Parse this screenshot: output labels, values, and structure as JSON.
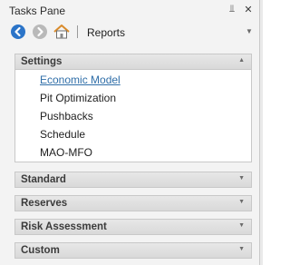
{
  "titlebar": {
    "title": "Tasks Pane",
    "pin_glyph": "⫫",
    "close_glyph": "✕"
  },
  "navbar": {
    "title": "Reports"
  },
  "sections": [
    {
      "title": "Settings",
      "expanded": true,
      "items": [
        "Economic Model",
        "Pit Optimization",
        "Pushbacks",
        "Schedule",
        "MAO-MFO"
      ]
    },
    {
      "title": "Standard",
      "expanded": false
    },
    {
      "title": "Reserves",
      "expanded": false
    },
    {
      "title": "Risk Assessment",
      "expanded": false
    },
    {
      "title": "Custom",
      "expanded": false
    }
  ],
  "glyphs": {
    "chevron_up": "▲",
    "chevron_down": "▼",
    "dropdown": "▼"
  },
  "colors": {
    "back_button": "#2b74c8",
    "forward_button": "#b9b9b9",
    "link": "#2f6ea8",
    "home_roof": "#d98b2b"
  }
}
